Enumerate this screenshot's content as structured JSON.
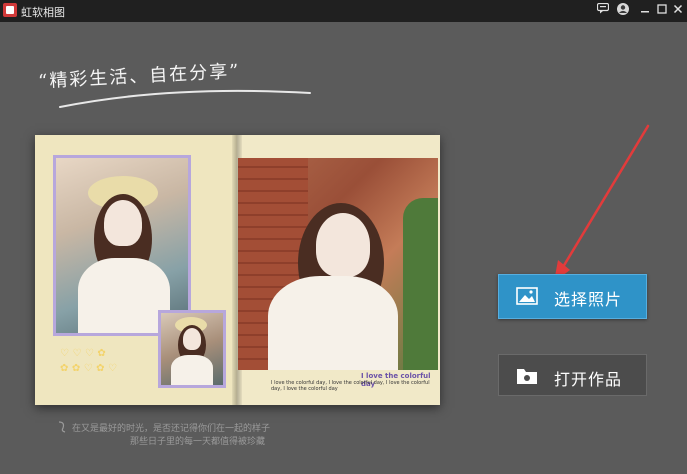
{
  "window": {
    "title": "虹软相图",
    "controls": [
      "message-icon",
      "user-icon",
      "minimize-icon",
      "maximize-icon",
      "close-icon"
    ]
  },
  "main": {
    "slogan": "“精彩生活、自在分享”",
    "album": {
      "caption_title": "I love the colorful day",
      "caption_line": "I love the colorful day, I love the colorful day, I love the colorful day, I love the colorful day"
    },
    "bottom_note": {
      "line1": "在又是最好的时光，是否还记得你们在一起的样子",
      "line2": "那些日子里的每一天都值得被珍藏"
    },
    "buttons": {
      "select_photos": "选择照片",
      "open_work": "打开作品"
    }
  },
  "colors": {
    "accent": "#2f93c8",
    "arrow": "#e23b3b",
    "background": "#5b5b5b"
  }
}
